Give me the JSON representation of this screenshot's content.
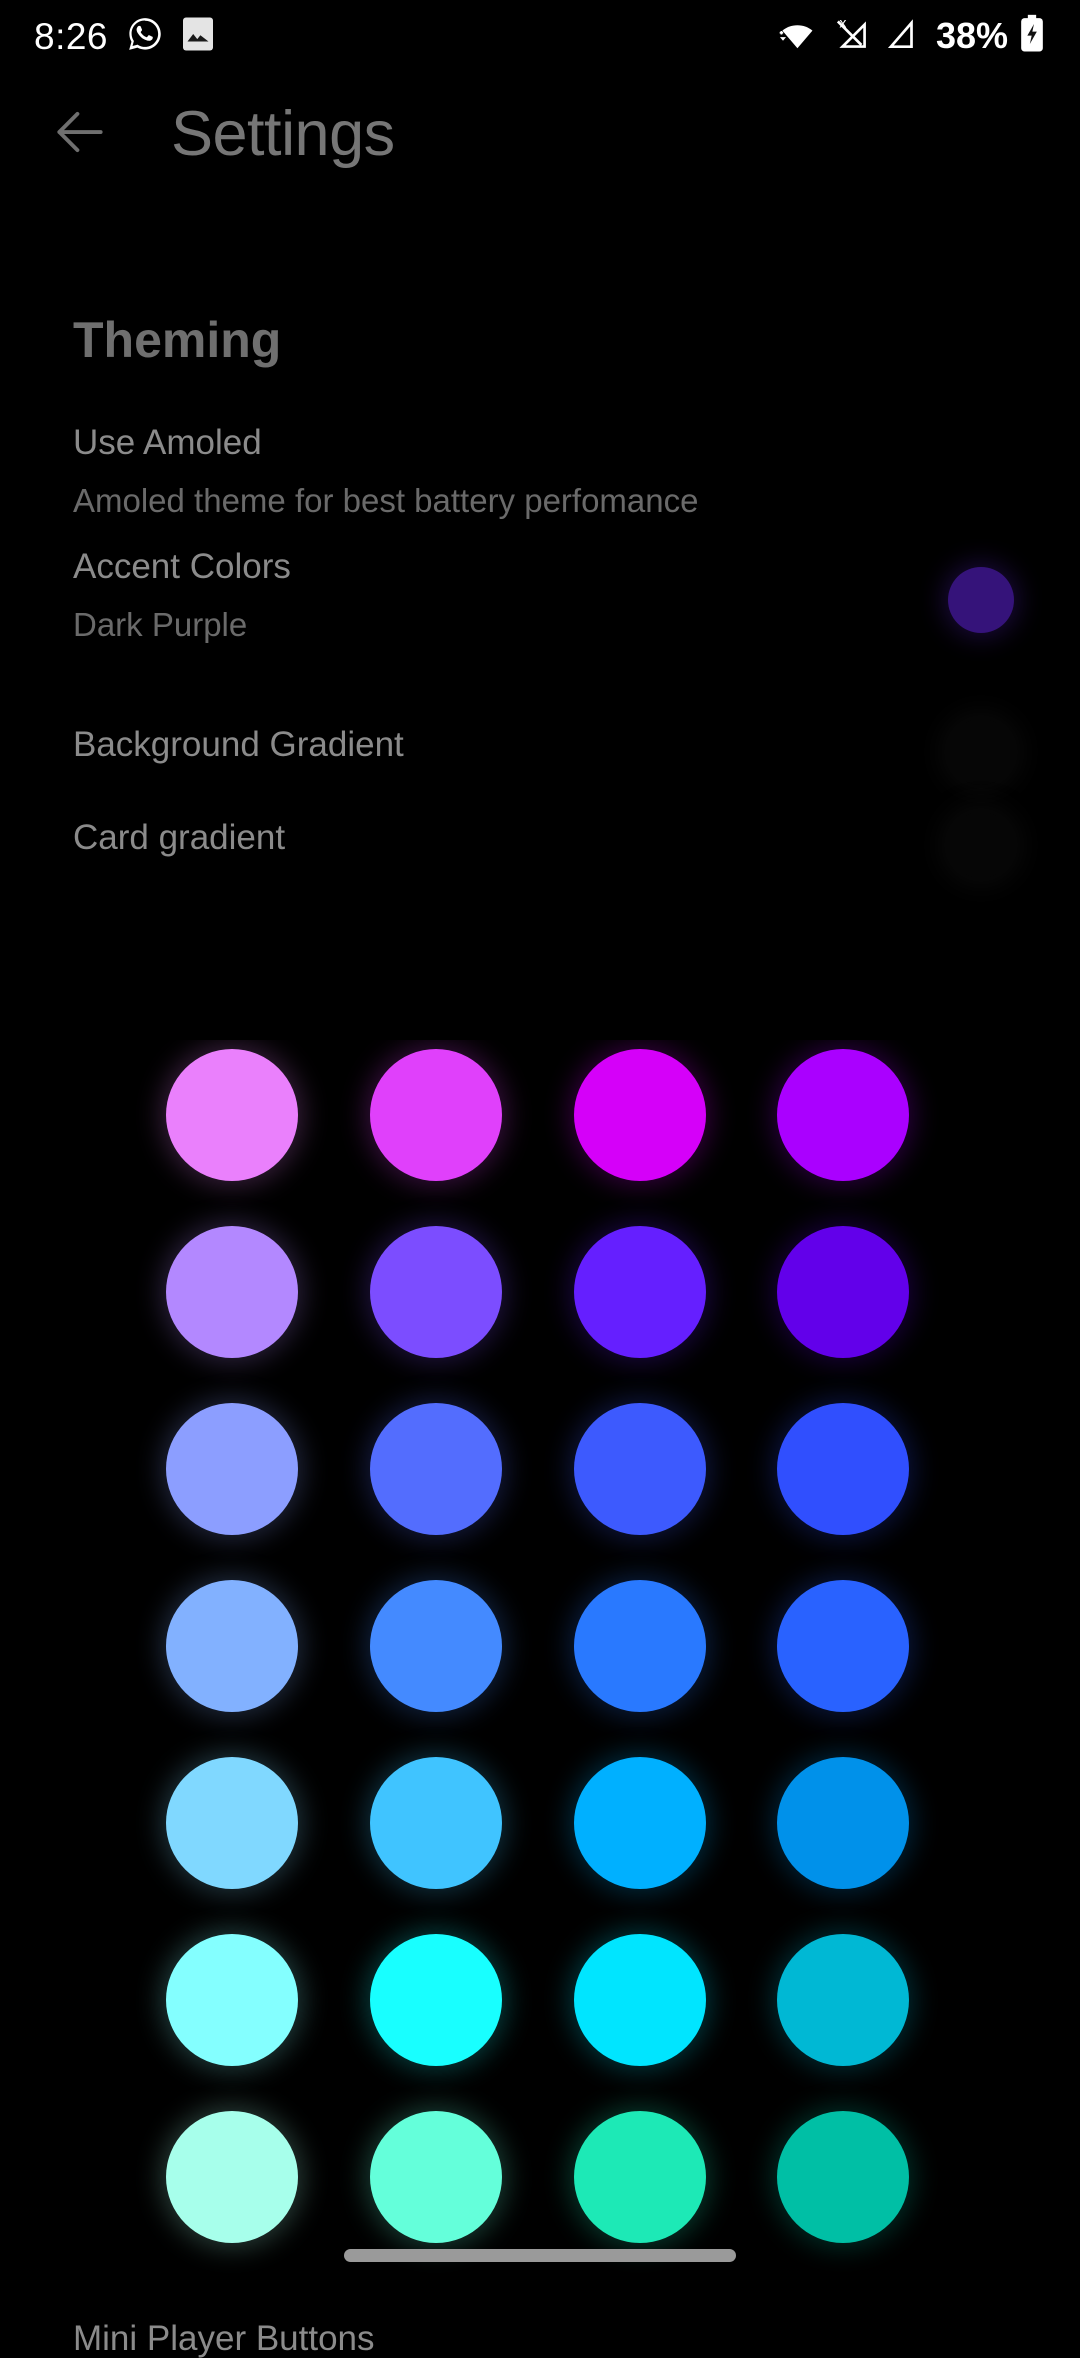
{
  "status_bar": {
    "time": "8:26",
    "battery_percent": "38%",
    "left_icons": [
      "whatsapp-icon",
      "image-icon"
    ],
    "right_icons": [
      "wifi-no-internet-icon",
      "signal-no-sim-icon",
      "signal-bars-icon",
      "battery-charging-icon"
    ]
  },
  "app_bar": {
    "back_icon": "arrow-left-icon",
    "title": "Settings"
  },
  "theming": {
    "header": "Theming",
    "preferences": [
      {
        "title": "Use Amoled",
        "summary": "Amoled theme for best battery perfomance",
        "swatch": null
      },
      {
        "title": "Accent Colors",
        "summary": "Dark Purple",
        "swatch": "#35137a"
      },
      {
        "title": "Background Gradient",
        "summary": "",
        "swatch": "#060606"
      },
      {
        "title": "Card gradient",
        "summary": "",
        "swatch": "#060606"
      }
    ]
  },
  "color_picker": {
    "selected": "#35137a",
    "rows": [
      [
        "#ea80fc",
        "#e040fb",
        "#d500f9",
        "#aa00ff"
      ],
      [
        "#b388ff",
        "#7c4dff",
        "#651fff",
        "#6200ea"
      ],
      [
        "#8c9eff",
        "#536dfe",
        "#3d5afe",
        "#304ffe"
      ],
      [
        "#82b1ff",
        "#448aff",
        "#2979ff",
        "#2962ff"
      ],
      [
        "#80d8ff",
        "#40c4ff",
        "#00b0ff",
        "#0091ea"
      ],
      [
        "#84ffff",
        "#18ffff",
        "#00e5ff",
        "#00b8d4"
      ],
      [
        "#a7ffeb",
        "#64ffda",
        "#1de9b6",
        "#00bfa5"
      ]
    ]
  },
  "bottom": {
    "mini_player_label": "Mini Player Buttons",
    "gesture_bar": "home-gesture-bar"
  },
  "colors": {
    "background": "#000000",
    "title_text": "#767676",
    "primary_text": "#8b8b8b",
    "secondary_text": "#6a6a6a",
    "section_header": "#6f6f6f",
    "status_text": "#ffffff"
  }
}
